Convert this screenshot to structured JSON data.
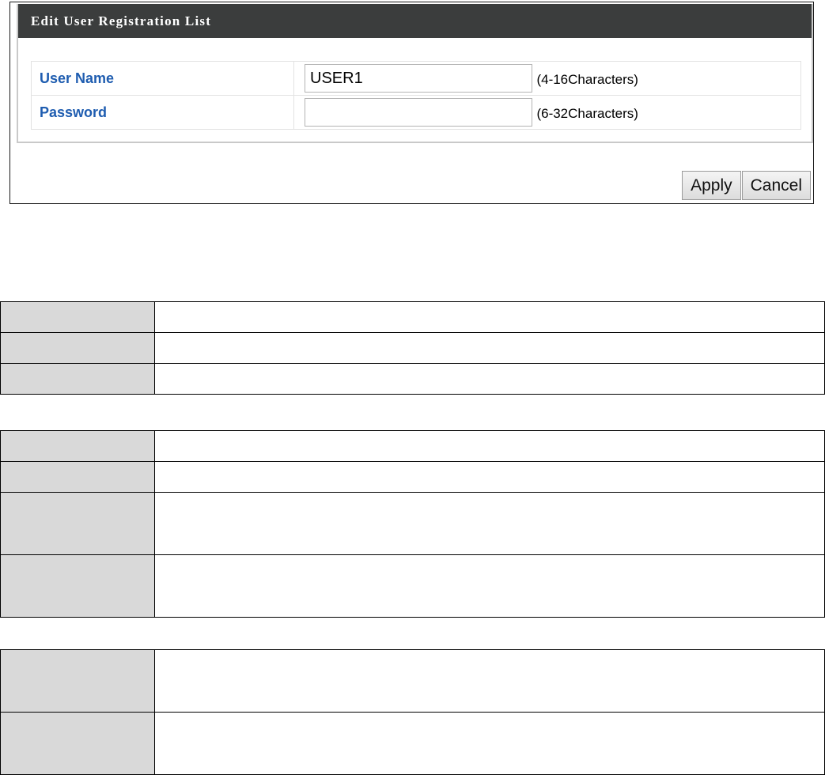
{
  "panel": {
    "title": "Edit User Registration List",
    "rows": [
      {
        "label": "User Name",
        "value": "USER1",
        "placeholder": "",
        "hint": "(4-16Characters)"
      },
      {
        "label": "Password",
        "value": "",
        "placeholder": "",
        "hint": "(6-32Characters)"
      }
    ],
    "buttons": {
      "apply": "Apply",
      "cancel": "Cancel"
    }
  },
  "description_tables": [
    {
      "rows": [
        {
          "key": "",
          "value": ""
        },
        {
          "key": "",
          "value": ""
        },
        {
          "key": "",
          "value": ""
        }
      ]
    },
    {
      "rows": [
        {
          "key": "",
          "value": ""
        },
        {
          "key": "",
          "value": ""
        },
        {
          "key": "",
          "value": ""
        },
        {
          "key": "",
          "value": ""
        }
      ]
    },
    {
      "rows": [
        {
          "key": "",
          "value": ""
        },
        {
          "key": "",
          "value": ""
        }
      ]
    }
  ],
  "colors": {
    "title_bar": "#3b3d3d",
    "label_text": "#1f5db0",
    "key_cell_bg": "#d9d9d9"
  }
}
